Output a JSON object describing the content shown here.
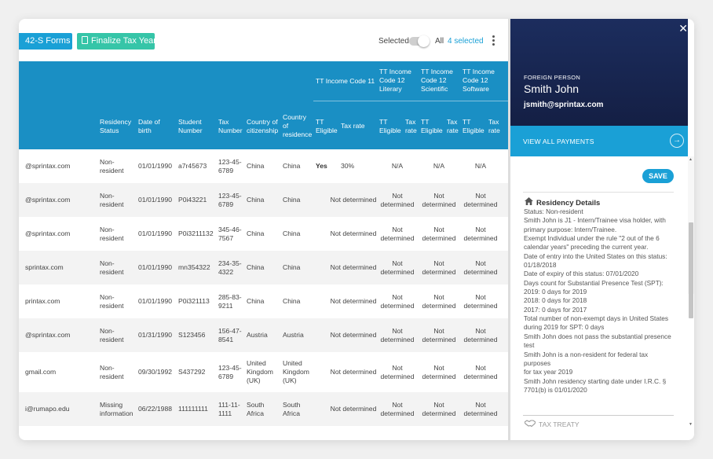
{
  "toolbar": {
    "forms_label": "42-S Forms",
    "finalize_label": "Finalize Tax Year",
    "selected_label": "Selected",
    "all_label": "All",
    "selected_count": "4 selected"
  },
  "table": {
    "headers": {
      "residency_status": [
        "Residency",
        "Status"
      ],
      "dob": [
        "Date of",
        "birth"
      ],
      "student_number": [
        "Student",
        "Number"
      ],
      "tax_number": [
        "Tax",
        "Number"
      ],
      "country_citizenship": [
        "Country of",
        "citizenship"
      ],
      "country_residence": [
        "Country",
        "of",
        "residence"
      ],
      "tt_income_code_11": "TT Income Code 11",
      "tt_eligible": [
        "TT",
        "Eligible"
      ],
      "tax_rate": "Tax rate",
      "tt_literary": [
        "TT Income",
        "Code 12",
        "Literary"
      ],
      "tt_scientific": [
        "TT Income",
        "Code 12",
        "Scientific"
      ],
      "tt_software": [
        "TT Income",
        "Code 12",
        "Software"
      ],
      "tax_rate_wrapped": [
        "Tax",
        "rate"
      ]
    },
    "rows": [
      {
        "email": "@sprintax.com",
        "status": [
          "Non-",
          "resident"
        ],
        "dob": "01/01/1990",
        "student_number": "a7r45673",
        "tax_number": [
          "123-45-",
          "6789"
        ],
        "citizenship": [
          "China"
        ],
        "residence": [
          "China"
        ],
        "tt_eligible": "Yes",
        "tax_rate": "30%",
        "literary": [
          "N/A"
        ],
        "scientific": [
          "N/A"
        ],
        "software": [
          "N/A"
        ]
      },
      {
        "email": "@sprintax.com",
        "status": [
          "Non-",
          "resident"
        ],
        "dob": "01/01/1990",
        "student_number": "P0i43221",
        "tax_number": [
          "123-45-",
          "6789"
        ],
        "citizenship": [
          "China"
        ],
        "residence": [
          "China"
        ],
        "tt_code11": "Not determined",
        "literary": [
          "Not",
          "determined"
        ],
        "scientific": [
          "Not",
          "determined"
        ],
        "software": [
          "Not",
          "determined"
        ]
      },
      {
        "email": "@sprintax.com",
        "status": [
          "Non-",
          "resident"
        ],
        "dob": "01/01/1990",
        "student_number": "P0i3211132",
        "tax_number": [
          "345-46-",
          "7567"
        ],
        "citizenship": [
          "China"
        ],
        "residence": [
          "China"
        ],
        "tt_code11": "Not determined",
        "literary": [
          "Not",
          "determined"
        ],
        "scientific": [
          "Not",
          "determined"
        ],
        "software": [
          "Not",
          "determined"
        ]
      },
      {
        "email": "sprintax.com",
        "status": [
          "Non-",
          "resident"
        ],
        "dob": "01/01/1990",
        "student_number": "mn354322",
        "tax_number": [
          "234-35-",
          "4322"
        ],
        "citizenship": [
          "China"
        ],
        "residence": [
          "China"
        ],
        "tt_code11": "Not determined",
        "literary": [
          "Not",
          "determined"
        ],
        "scientific": [
          "Not",
          "determined"
        ],
        "software": [
          "Not",
          "determined"
        ]
      },
      {
        "email": "printax.com",
        "status": [
          "Non-",
          "resident"
        ],
        "dob": "01/01/1990",
        "student_number": "P0i321113",
        "tax_number": [
          "285-83-",
          "9211"
        ],
        "citizenship": [
          "China"
        ],
        "residence": [
          "China"
        ],
        "tt_code11": "Not determined",
        "literary": [
          "Not",
          "determined"
        ],
        "scientific": [
          "Not",
          "determined"
        ],
        "software": [
          "Not",
          "determined"
        ]
      },
      {
        "email": "@sprintax.com",
        "status": [
          "Non-",
          "resident"
        ],
        "dob": "01/31/1990",
        "student_number": "S123456",
        "tax_number": [
          "156-47-",
          "8541"
        ],
        "citizenship": [
          "Austria"
        ],
        "residence": [
          "Austria"
        ],
        "tt_code11": "Not determined",
        "literary": [
          "Not",
          "determined"
        ],
        "scientific": [
          "Not",
          "determined"
        ],
        "software": [
          "Not",
          "determined"
        ]
      },
      {
        "email": "gmail.com",
        "status": [
          "Non-",
          "resident"
        ],
        "dob": "09/30/1992",
        "student_number": "S437292",
        "tax_number": [
          "123-45-",
          "6789"
        ],
        "citizenship": [
          "United",
          "Kingdom",
          "(UK)"
        ],
        "residence": [
          "United",
          "Kingdom",
          "(UK)"
        ],
        "tt_code11": "Not determined",
        "literary": [
          "Not",
          "determined"
        ],
        "scientific": [
          "Not",
          "determined"
        ],
        "software": [
          "Not",
          "determined"
        ]
      },
      {
        "email": "i@rumapo.edu",
        "status": [
          "Missing",
          "information"
        ],
        "dob": "06/22/1988",
        "student_number": "111111111",
        "tax_number": [
          "111-11-",
          "1111"
        ],
        "citizenship": [
          "South",
          "Africa"
        ],
        "residence": [
          "South",
          "Africa"
        ],
        "tt_code11": "Not determined",
        "literary": [
          "Not",
          "determined"
        ],
        "scientific": [
          "Not",
          "determined"
        ],
        "software": [
          "Not",
          "determined"
        ]
      }
    ]
  },
  "panel": {
    "kicker": "FOREIGN PERSON",
    "name": "Smith John",
    "email": "jsmith@sprintax.com",
    "view_payments": "VIEW ALL PAYMENTS",
    "save_label": "SAVE",
    "residency_title": "Residency Details",
    "residency_lines": [
      "Status: Non-resident",
      "Smith John is J1 - Intern/Trainee visa holder, with",
      "primary purpose: Intern/Trainee.",
      "Exempt Individual under the rule \"2 out of the 6",
      "calendar years\" preceding the current year.",
      "Date of entry into the United States on this status:",
      "01/18/2018",
      "Date of expiry of this status: 07/01/2020",
      "Days count for Substantial Presence Test (SPT):",
      "2019: 0 days for 2019",
      "2018: 0 days for 2018",
      "2017: 0 days for 2017",
      "Total number of non-exempt days in United States",
      "during 2019 for SPT: 0 days",
      "Smith John does not pass the substantial presence",
      "test",
      "Smith John is a non-resident for federal tax purposes",
      "for tax year 2019",
      "Smith John residency starting date under I.R.C. §",
      "7701(b) is 01/01/2020"
    ],
    "treaty_label": "TAX TREATY"
  },
  "colors": {
    "accent_blue": "#1aa0d6",
    "teal": "#36c5a8",
    "header_blue": "#1a8fc4",
    "navy": "#1c2d5e"
  }
}
